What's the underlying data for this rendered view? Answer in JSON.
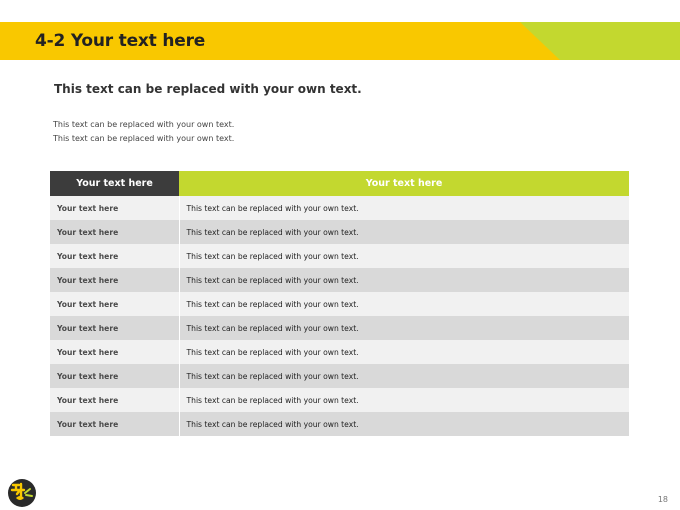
{
  "header": {
    "title": "4-2 Your text here"
  },
  "subtitle": "This text can be replaced with your own text.",
  "description": [
    "This text can be replaced with your own text.",
    "This text can be replaced with your own text."
  ],
  "table": {
    "headers": [
      "Your text here",
      "Your text here"
    ],
    "rows": [
      {
        "key": "Your text here",
        "value": "This text can be replaced with your own text."
      },
      {
        "key": "Your text here",
        "value": "This text can be replaced with your own text."
      },
      {
        "key": "Your text here",
        "value": "This text can be replaced with your own text."
      },
      {
        "key": "Your text here",
        "value": "This text can be replaced with your own text."
      },
      {
        "key": "Your text here",
        "value": "This text can be replaced with your own text."
      },
      {
        "key": "Your text here",
        "value": "This text can be replaced with your own text."
      },
      {
        "key": "Your text here",
        "value": "This text can be replaced with your own text."
      },
      {
        "key": "Your text here",
        "value": "This text can be replaced with your own text."
      },
      {
        "key": "Your text here",
        "value": "This text can be replaced with your own text."
      },
      {
        "key": "Your text here",
        "value": "This text can be replaced with your own text."
      }
    ]
  },
  "footer": {
    "page_number": "18"
  },
  "colors": {
    "banner_yellow": "#f9c800",
    "banner_green": "#c3d82f",
    "header_dark": "#3c3c3c",
    "row_light": "#f1f1f1",
    "row_dark": "#d9d9d9"
  },
  "icons": {
    "logo": "brand-logo-icon"
  }
}
